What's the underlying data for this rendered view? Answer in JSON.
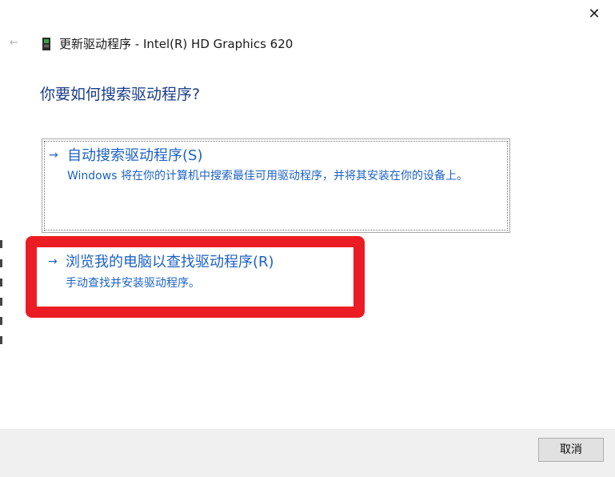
{
  "window": {
    "title": "更新驱动程序 - Intel(R) HD Graphics 620",
    "close_symbol": "✕",
    "back_symbol": "←"
  },
  "prompt": {
    "heading": "你要如何搜索驱动程序?"
  },
  "options": [
    {
      "arrow": "→",
      "title": "自动搜索驱动程序(S)",
      "description": "Windows 将在你的计算机中搜索最佳可用驱动程序，并将其安装在你的设备上。"
    },
    {
      "arrow": "→",
      "title": "浏览我的电脑以查找驱动程序(R)",
      "description": "手动查找并安装驱动程序。"
    }
  ],
  "footer": {
    "cancel_label": "取消"
  },
  "icons": {
    "device": "graphics-card-icon",
    "back": "back-arrow-icon",
    "close": "close-icon"
  },
  "colors": {
    "heading": "#1b3e8a",
    "link": "#1c62c4",
    "highlight": "#ec1c24",
    "footer_bg": "#f0f0f0"
  }
}
